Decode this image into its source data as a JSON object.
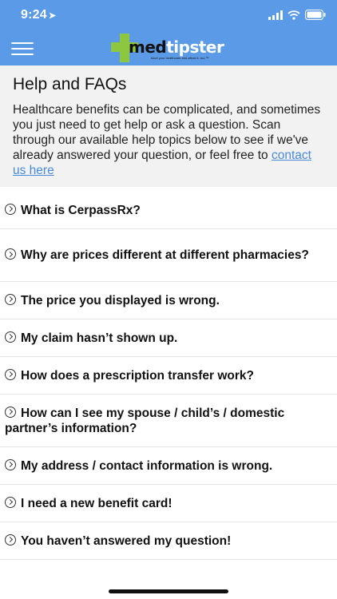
{
  "status_bar": {
    "time": "9:24",
    "icons": [
      "location-arrow-icon",
      "cellular-signal-icon",
      "wifi-icon",
      "battery-icon"
    ]
  },
  "header": {
    "logo": {
      "part1": "med",
      "part2": "tipster",
      "tagline": "have your healthcare and afford it, too.™"
    },
    "menu_icon": "hamburger-menu-icon"
  },
  "intro": {
    "title": "Help and FAQs",
    "body": "Healthcare benefits can be complicated, and sometimes you just need to get help or ask a question. Scan through our available help topics below to see if we've already answered your question, or feel free to ",
    "link": "contact us here"
  },
  "faqs": [
    "What is CerpassRx?",
    "Why are prices different at different pharmacies?",
    "The price you displayed is wrong.",
    "My claim hasn’t shown up.",
    "How does a prescription transfer work?",
    "How can I see my spouse / child’s / domestic partner’s information?",
    "My address / contact information is wrong.",
    "I need a new benefit card!",
    "You haven’t answered my question!"
  ],
  "colors": {
    "header": "#5b9ae6",
    "logo_cross": "#8dc63f",
    "link": "#4a8ad8",
    "intro_bg": "#f2f2f2"
  }
}
